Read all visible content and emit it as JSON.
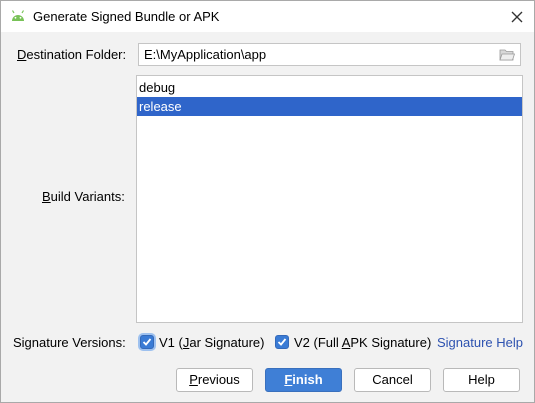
{
  "window": {
    "title": "Generate Signed Bundle or APK",
    "icon": "android-icon"
  },
  "destination": {
    "label_mnemonic": "D",
    "label_rest": "estination Folder:",
    "value": "E:\\MyApplication\\app"
  },
  "build_variants": {
    "label_mnemonic": "B",
    "label_rest": "uild Variants:",
    "items": [
      {
        "label": "debug",
        "selected": false
      },
      {
        "label": "release",
        "selected": true
      }
    ]
  },
  "signature": {
    "label": "Signature Versions:",
    "v1": {
      "pre": "V1 (",
      "mnemonic": "J",
      "post": "ar Signature)",
      "checked": true
    },
    "v2": {
      "pre": "V2 (Full ",
      "mnemonic": "A",
      "post": "PK Signature)",
      "checked": true
    },
    "help_link": "Signature Help"
  },
  "buttons": {
    "previous": {
      "mnemonic": "P",
      "rest": "revious"
    },
    "finish": {
      "mnemonic": "F",
      "rest": "inish"
    },
    "cancel": "Cancel",
    "help": "Help"
  },
  "colors": {
    "selection": "#2f65ca",
    "primary_button": "#3f7fd6",
    "link": "#2d52b0",
    "android_green": "#78c257"
  }
}
